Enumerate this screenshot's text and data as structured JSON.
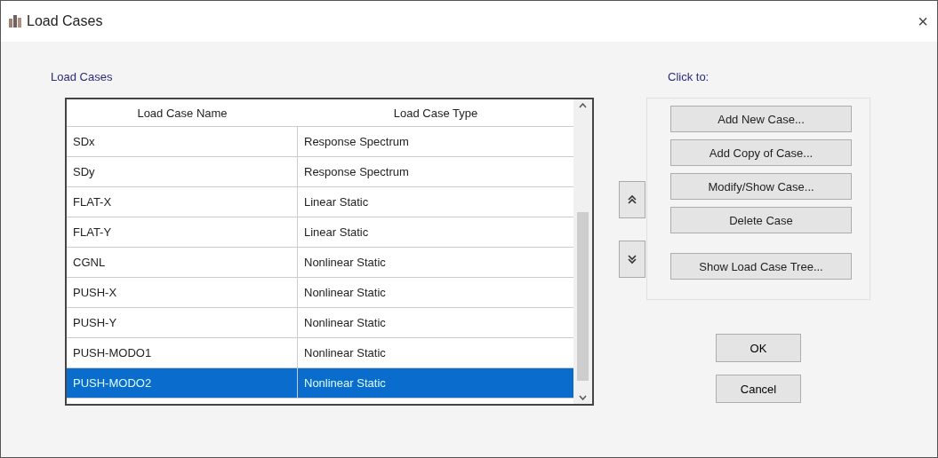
{
  "window": {
    "title": "Load Cases",
    "close": "×"
  },
  "load_cases": {
    "label": "Load Cases",
    "columns": [
      "Load Case Name",
      "Load Case Type"
    ],
    "rows": [
      {
        "name": "SDx",
        "type": "Response Spectrum",
        "selected": false
      },
      {
        "name": "SDy",
        "type": "Response Spectrum",
        "selected": false
      },
      {
        "name": "FLAT-X",
        "type": "Linear Static",
        "selected": false
      },
      {
        "name": "FLAT-Y",
        "type": "Linear Static",
        "selected": false
      },
      {
        "name": "CGNL",
        "type": "Nonlinear Static",
        "selected": false
      },
      {
        "name": "PUSH-X",
        "type": "Nonlinear Static",
        "selected": false
      },
      {
        "name": "PUSH-Y",
        "type": "Nonlinear Static",
        "selected": false
      },
      {
        "name": "PUSH-MODO1",
        "type": "Nonlinear Static",
        "selected": false
      },
      {
        "name": "PUSH-MODO2",
        "type": "Nonlinear Static",
        "selected": true
      }
    ]
  },
  "click_to": {
    "label": "Click to:",
    "buttons": [
      "Add New Case...",
      "Add Copy of Case...",
      "Modify/Show Case...",
      "Delete Case"
    ],
    "tree_button": "Show Load Case Tree..."
  },
  "dialog_buttons": [
    "OK",
    "Cancel"
  ]
}
